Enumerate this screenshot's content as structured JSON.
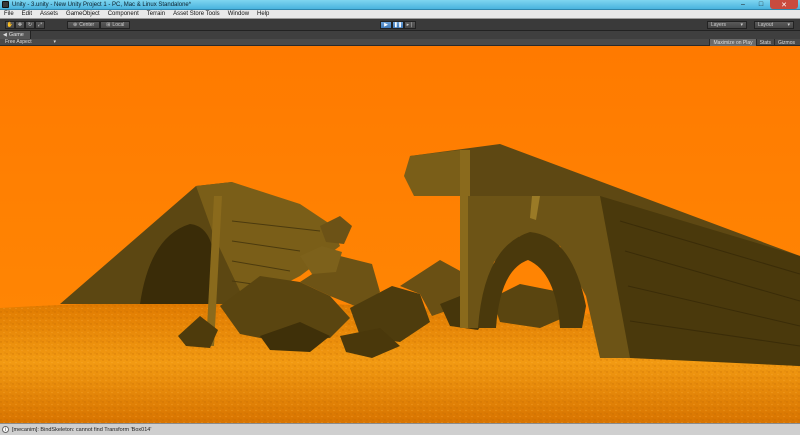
{
  "window": {
    "title": "Unity - 3.unity - New Unity Project 1 - PC, Mac & Linux Standalone*",
    "controls": [
      "–",
      "□",
      "✕"
    ]
  },
  "menu": [
    "File",
    "Edit",
    "Assets",
    "GameObject",
    "Component",
    "Terrain",
    "Asset Store Tools",
    "Window",
    "Help"
  ],
  "toolbar": {
    "pivot_label": "Center",
    "space_label": "Local",
    "layers_label": "Layers",
    "layout_label": "Layout"
  },
  "game_view": {
    "tab_label": "Game",
    "aspect_label": "Free Aspect",
    "maximize_label": "Maximize on Play",
    "stats_label": "Stats",
    "gizmos_label": "Gizmos"
  },
  "status": {
    "message": "[mecanim]: BindSkeleton: cannot find Transform 'Box014'"
  },
  "colors": {
    "sky": "#ff7f00",
    "ground": "#e88000",
    "structure": "#6b5316",
    "play_active": "#4a86c5"
  }
}
